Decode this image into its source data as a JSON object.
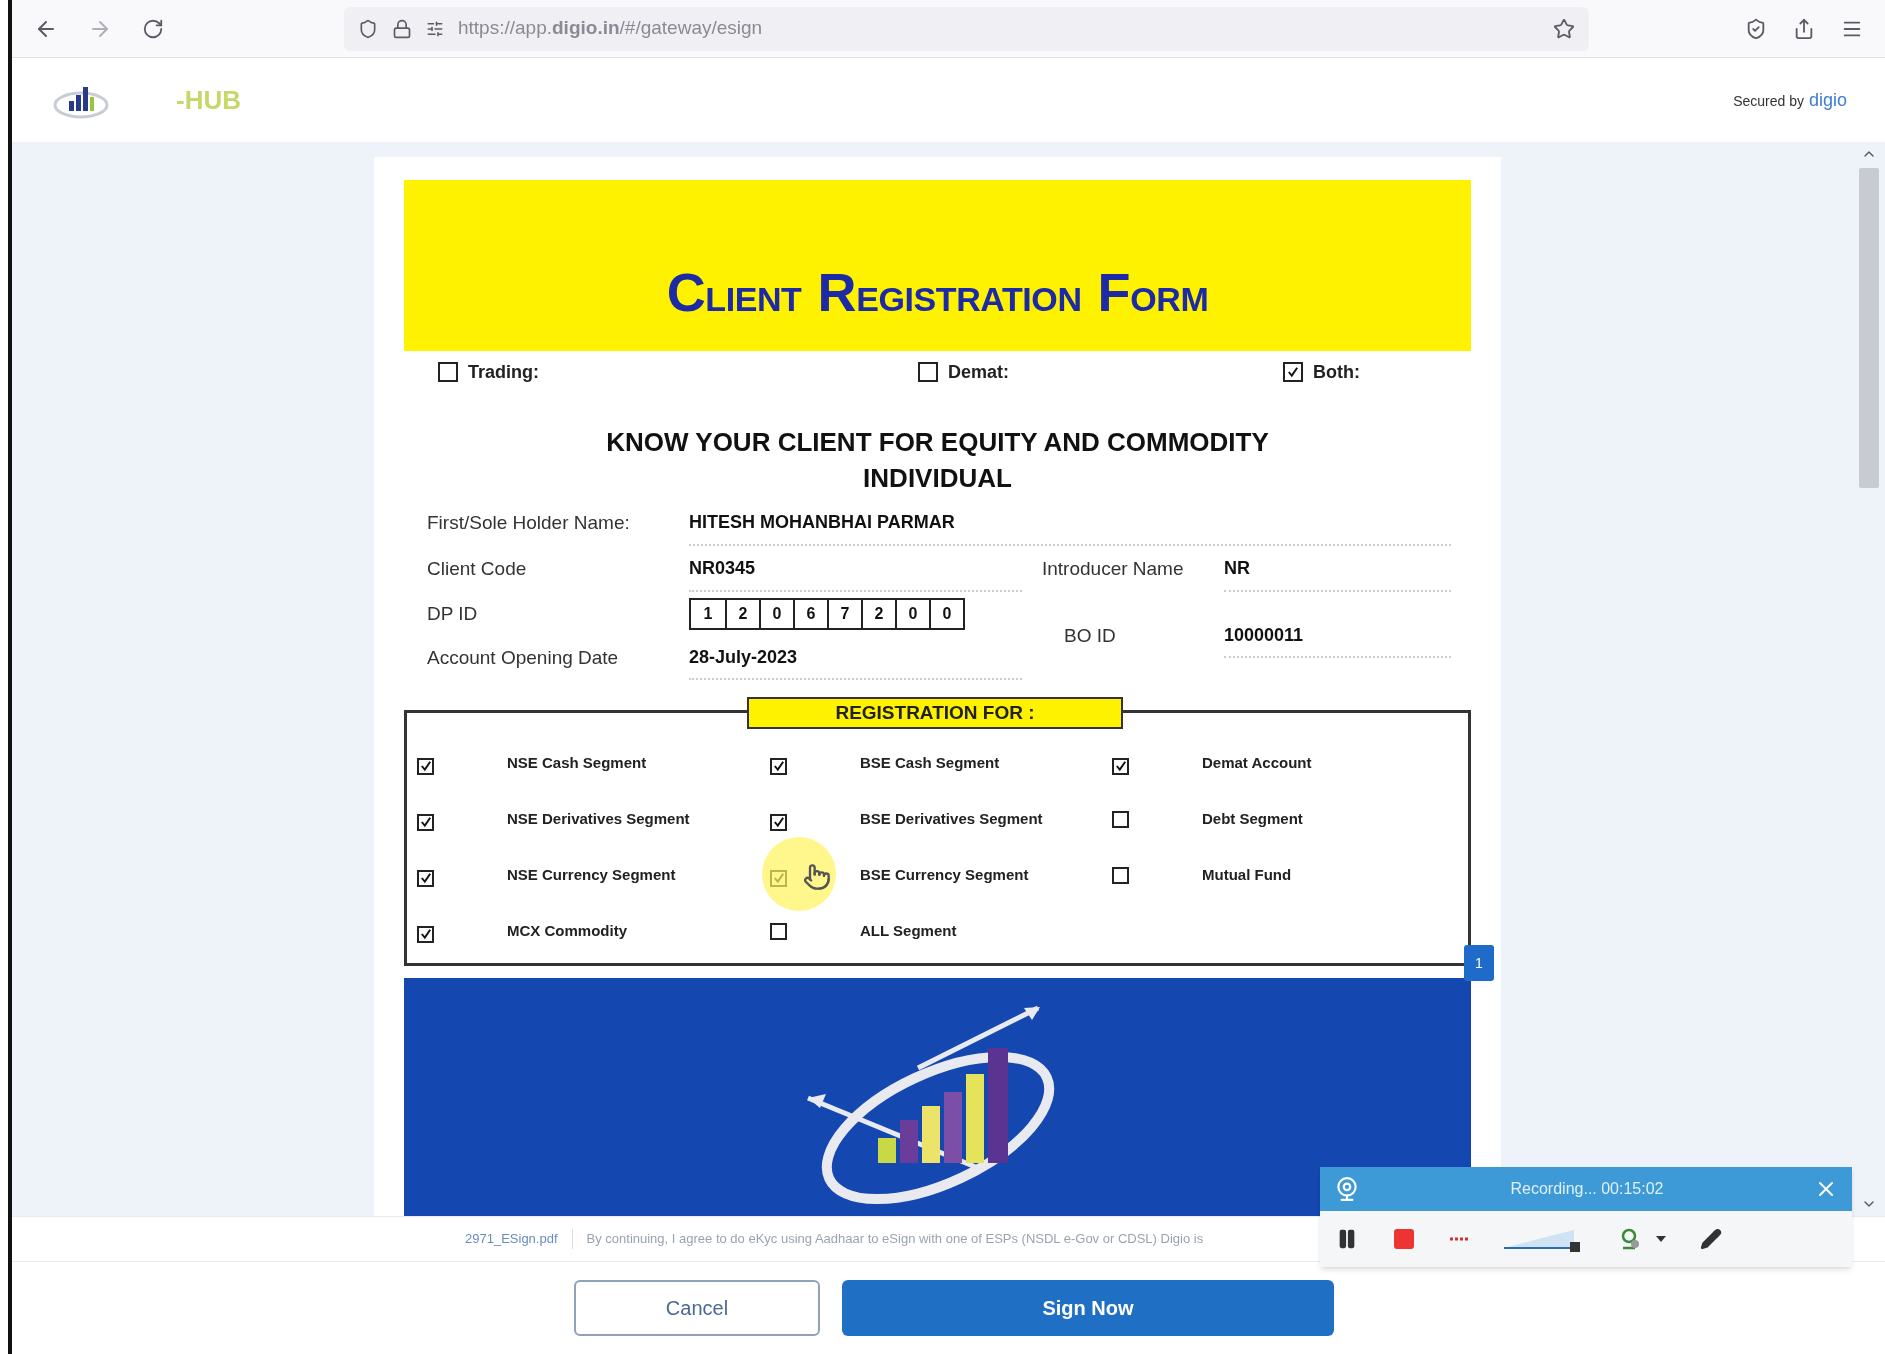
{
  "browser": {
    "url": "https://app.**digio.in**/#/gateway/esign"
  },
  "header": {
    "logo_text": "-HUB",
    "secured_label": "Secured by",
    "secured_brand": "digio"
  },
  "form": {
    "title": "CLIENT REGISTRATION FORM",
    "account_types": [
      {
        "label": "Trading:",
        "checked": false
      },
      {
        "label": "Demat:",
        "checked": false
      },
      {
        "label": "Both:",
        "checked": true
      }
    ],
    "heading": [
      "KNOW YOUR CLIENT FOR EQUITY AND COMMODITY",
      "INDIVIDUAL"
    ],
    "holder_label": "First/Sole Holder Name:",
    "holder_value": "HITESH MOHANBHAI PARMAR",
    "client_code_label": "Client Code",
    "client_code_value": "NR0345",
    "introducer_label": "Introducer Name",
    "introducer_value": "NR",
    "dp_id_label": "DP ID",
    "dp_id_digits": [
      "1",
      "2",
      "0",
      "6",
      "7",
      "2",
      "0",
      "0"
    ],
    "bo_id_label": "BO ID",
    "bo_id_value": "10000011",
    "opening_date_label": "Account Opening Date",
    "opening_date_value": "28-July-2023",
    "registration_title": "REGISTRATION FOR :",
    "segments": [
      {
        "label": "NSE Cash Segment",
        "checked": true
      },
      {
        "label": "BSE Cash Segment",
        "checked": true
      },
      {
        "label": "Demat Account",
        "checked": true
      },
      {
        "label": "NSE Derivatives Segment",
        "checked": true
      },
      {
        "label": "BSE Derivatives Segment",
        "checked": true
      },
      {
        "label": "Debt Segment",
        "checked": false
      },
      {
        "label": "NSE Currency Segment",
        "checked": true
      },
      {
        "label": "BSE Currency Segment",
        "checked": true
      },
      {
        "label": "Mutual Fund",
        "checked": false
      },
      {
        "label": "MCX Commodity",
        "checked": true
      },
      {
        "label": "ALL Segment",
        "checked": false
      }
    ],
    "page_marker": "1"
  },
  "document_bar": {
    "filename": "2971_ESign.pdf",
    "consent": "By continuing, I agree to do eKyc using Aadhaar to eSign with one of ESPs (NSDL e-Gov or CDSL) Digio is"
  },
  "buttons": [
    {
      "kind": "secondary",
      "label": "Cancel"
    },
    {
      "kind": "primary",
      "label": "Sign Now"
    }
  ],
  "recorder": {
    "status": "Recording... 00:15:02"
  }
}
